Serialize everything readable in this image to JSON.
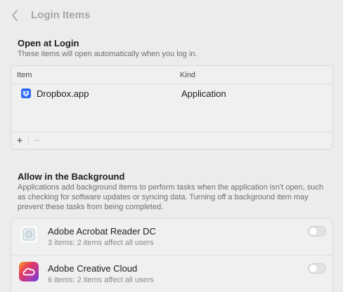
{
  "header": {
    "title": "Login Items",
    "back_icon": "chevron-left-icon"
  },
  "open_at_login": {
    "title": "Open at Login",
    "description": "These items will open automatically when you log in.",
    "columns": {
      "item": "Item",
      "kind": "Kind"
    },
    "items": [
      {
        "icon": "dropbox-icon",
        "name": "Dropbox.app",
        "kind": "Application"
      }
    ],
    "add_label": "+",
    "remove_label": "−"
  },
  "background": {
    "title": "Allow in the Background",
    "description": "Applications add background items to perform tasks when the application isn't open, such as checking for software updates or syncing data. Turning off a background item may prevent these tasks from being completed.",
    "items": [
      {
        "icon": "adobe-acrobat-reader-icon",
        "name": "Adobe Acrobat Reader DC",
        "detail": "3 items: 2 items affect all users",
        "enabled": false
      },
      {
        "icon": "adobe-creative-cloud-icon",
        "name": "Adobe Creative Cloud",
        "detail": "6 items: 2 items affect all users",
        "enabled": false
      }
    ]
  },
  "colors": {
    "window_bg": "#ececec",
    "accent_blue": "#2f6af6",
    "muted_text": "#6e6e73",
    "toggle_off": "#e3e3e3"
  }
}
